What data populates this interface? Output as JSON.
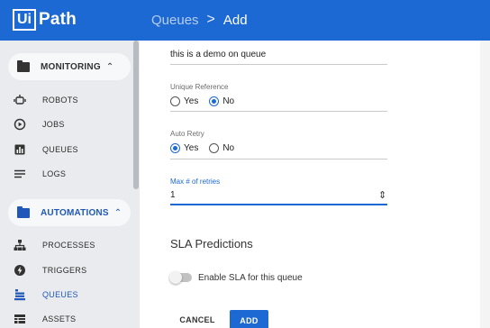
{
  "app": {
    "logo_box": "Ui",
    "logo_text": "Path"
  },
  "breadcrumb": {
    "parent": "Queues",
    "separator": ">",
    "current": "Add"
  },
  "sidebar": {
    "groups": [
      {
        "label": "MONITORING",
        "chevron": "^",
        "color": "#333333",
        "icon": "folder-icon"
      },
      {
        "label": "AUTOMATIONS",
        "chevron": "^",
        "color": "#1f58b8",
        "icon": "folder-icon"
      }
    ],
    "monitoring_items": [
      {
        "label": "ROBOTS",
        "icon": "robot-icon"
      },
      {
        "label": "JOBS",
        "icon": "play-circle-icon"
      },
      {
        "label": "QUEUES",
        "icon": "bar-chart-icon"
      },
      {
        "label": "LOGS",
        "icon": "lines-icon"
      }
    ],
    "automation_items": [
      {
        "label": "PROCESSES",
        "icon": "hierarchy-icon"
      },
      {
        "label": "TRIGGERS",
        "icon": "lightning-icon"
      },
      {
        "label": "QUEUES",
        "icon": "stack-icon",
        "active": true
      },
      {
        "label": "ASSETS",
        "icon": "table-icon"
      }
    ]
  },
  "form": {
    "description_value": "this is a demo on queue",
    "unique_reference": {
      "label": "Unique Reference",
      "options": [
        "Yes",
        "No"
      ],
      "selected": "No"
    },
    "auto_retry": {
      "label": "Auto Retry",
      "options": [
        "Yes",
        "No"
      ],
      "selected": "Yes"
    },
    "max_retries": {
      "label": "Max # of retries",
      "value": "1",
      "spinner": "⇕"
    },
    "sla_title": "SLA Predictions",
    "sla_toggle_label": "Enable SLA for this queue",
    "sla_enabled": false,
    "cancel_label": "CANCEL",
    "add_label": "ADD"
  },
  "colors": {
    "brand": "#1c69d4",
    "sidebar_bg": "#e9ebee",
    "active": "#1f58b8"
  }
}
